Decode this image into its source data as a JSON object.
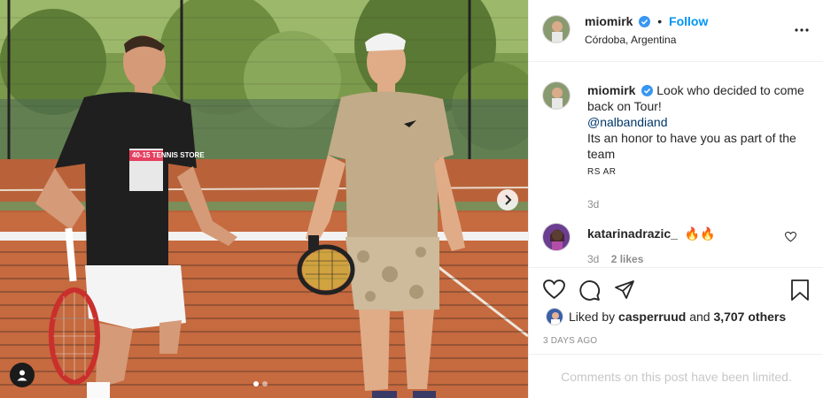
{
  "post": {
    "author": "miomirk",
    "follow_label": "Follow",
    "separator": "•",
    "location": "Córdoba, Argentina",
    "more_icon": "more-options-icon"
  },
  "caption": {
    "author": "miomirk",
    "line1": "Look who decided to come back on Tour!",
    "mention": "@nalbandiand",
    "line2": "Its an honor to have you as part of the team",
    "flags": "RS AR",
    "time": "3d"
  },
  "comment": {
    "author": "katarinadrazic_",
    "emoji": "🔥🔥",
    "time": "3d",
    "likes": "2 likes"
  },
  "engagement": {
    "liked_prefix": "Liked by",
    "liked_user": "casperruud",
    "liked_suffix_and": "and",
    "others": "3,707 others",
    "date": "3 DAYS AGO",
    "comments_limited": "Comments on this post have been limited."
  },
  "photo": {
    "shirt_text": "40-15 TENNIS STORE",
    "carousel_count": 2,
    "carousel_active": 1
  },
  "colors": {
    "verified": "#3897f0",
    "follow": "#0095f6",
    "clay": "#c66a3f"
  }
}
